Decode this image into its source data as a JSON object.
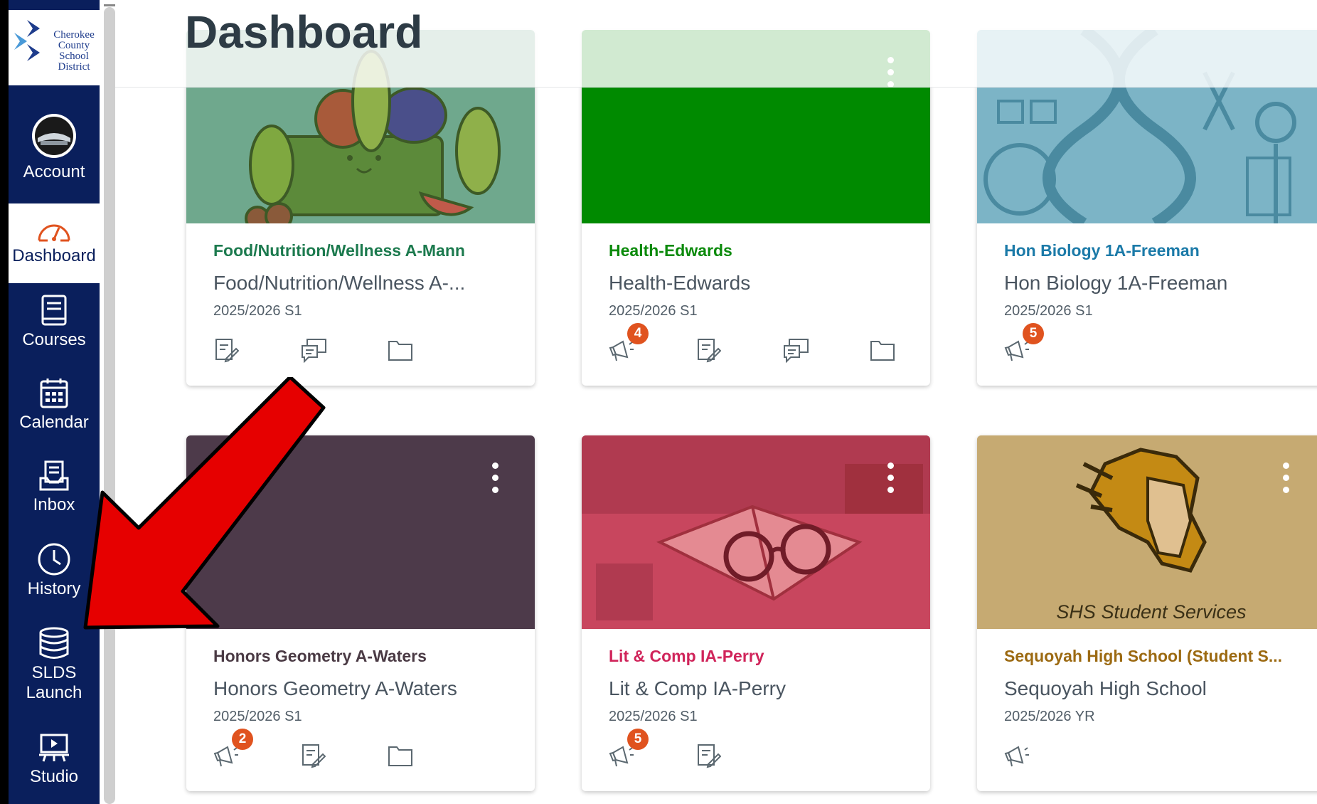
{
  "header": {
    "title": "Dashboard"
  },
  "nav": {
    "logo_text": [
      "Cherokee",
      "County",
      "School",
      "District"
    ],
    "items": [
      {
        "label": "Account",
        "icon": "account-avatar-icon"
      },
      {
        "label": "Dashboard",
        "icon": "dashboard-gauge-icon"
      },
      {
        "label": "Courses",
        "icon": "courses-book-icon"
      },
      {
        "label": "Calendar",
        "icon": "calendar-icon"
      },
      {
        "label": "Inbox",
        "icon": "inbox-icon"
      },
      {
        "label": "History",
        "icon": "history-clock-icon"
      },
      {
        "label": "SLDS Launch",
        "label_lines": [
          "SLDS",
          "Launch"
        ],
        "icon": "database-icon"
      },
      {
        "label": "Studio",
        "icon": "studio-icon"
      }
    ],
    "colors": {
      "nav_bg": "#0a1f5c",
      "active_bg": "#ffffff"
    }
  },
  "cards": [
    {
      "code": "Food/Nutrition/Wellness A-Mann",
      "name": "Food/Nutrition/Wellness A-...",
      "term": "2025/2026 S1",
      "color": "#1c7a4e",
      "hero": "#6fa88d",
      "actions": [
        {
          "icon": "assignments-icon"
        },
        {
          "icon": "discussions-icon"
        },
        {
          "icon": "files-icon"
        }
      ]
    },
    {
      "code": "Health-Edwards",
      "name": "Health-Edwards",
      "term": "2025/2026 S1",
      "color": "#0b8a0b",
      "hero": "#008a00",
      "actions": [
        {
          "icon": "announcements-icon",
          "badge": "4"
        },
        {
          "icon": "assignments-icon"
        },
        {
          "icon": "discussions-icon"
        },
        {
          "icon": "files-icon"
        }
      ]
    },
    {
      "code": "Hon Biology 1A-Freeman",
      "name": "Hon Biology 1A-Freeman",
      "term": "2025/2026 S1",
      "color": "#1b7aa8",
      "hero": "#7cb4c6",
      "actions": [
        {
          "icon": "announcements-icon",
          "badge": "5"
        }
      ]
    },
    {
      "code": "Honors Geometry A-Waters",
      "name": "Honors Geometry A-Waters",
      "term": "2025/2026 S1",
      "color": "#4a3a44",
      "hero": "#4d3a4a",
      "actions": [
        {
          "icon": "announcements-icon",
          "badge": "2"
        },
        {
          "icon": "assignments-icon"
        },
        {
          "icon": "files-icon"
        }
      ]
    },
    {
      "code": "Lit & Comp IA-Perry",
      "name": "Lit & Comp IA-Perry",
      "term": "2025/2026 S1",
      "color": "#d0245a",
      "hero": "#c8465e",
      "actions": [
        {
          "icon": "announcements-icon",
          "badge": "5"
        },
        {
          "icon": "assignments-icon"
        }
      ]
    },
    {
      "code": "Sequoyah High School (Student S...",
      "name": "Sequoyah High School",
      "term": "2025/2026 YR",
      "color": "#9c6a12",
      "hero": "#c6aa72",
      "hero_label": "SHS Student Services",
      "actions": [
        {
          "icon": "announcements-icon"
        }
      ]
    }
  ],
  "overlay": {
    "arrow_color": "#e60000"
  }
}
